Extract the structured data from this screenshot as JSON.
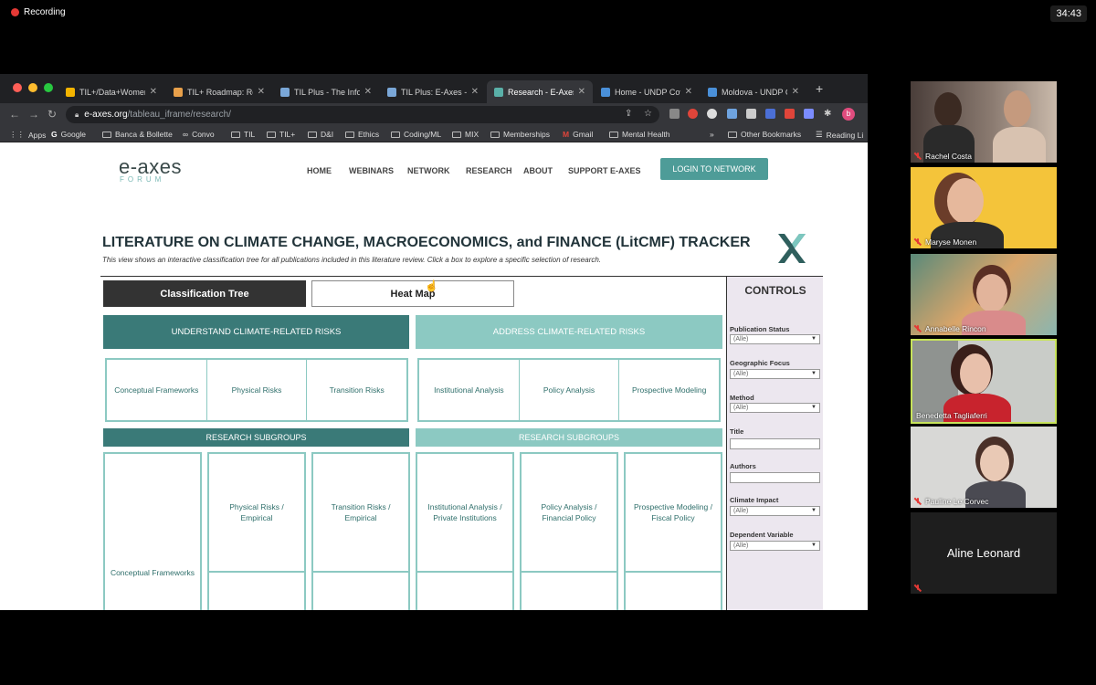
{
  "zoom": {
    "recording_label": "Recording",
    "timer": "34:43"
  },
  "browser": {
    "tabs": [
      {
        "label": "TIL+/Data+Womer",
        "fav_color": "#f4b400"
      },
      {
        "label": "TIL+ Roadmap: Ro",
        "fav_color": "#e8a04a"
      },
      {
        "label": "TIL Plus - The Infor",
        "fav_color": "#7aa7d8"
      },
      {
        "label": "TIL Plus: E-Axes - T",
        "fav_color": "#7aa7d8"
      },
      {
        "label": "Research - E-Axes",
        "fav_color": "#5ab0a8"
      },
      {
        "label": "Home - UNDP Cov",
        "fav_color": "#4a90d9"
      },
      {
        "label": "Moldova - UNDP C",
        "fav_color": "#4a90d9"
      }
    ],
    "url_host": "e-axes.org",
    "url_path": "/tableau_iframe/research/",
    "bookmarks": [
      "Apps",
      "Google",
      "Banca & Bollette",
      "Convo",
      "TIL",
      "TIL+",
      "D&I",
      "Ethics",
      "Coding/ML",
      "MIX",
      "Memberships",
      "Gmail",
      "Mental Health",
      "»",
      "Other Bookmarks",
      "Reading Li"
    ]
  },
  "site": {
    "logo_main": "e-axes",
    "logo_sub": "FORUM",
    "nav": [
      "HOME",
      "WEBINARS",
      "NETWORK",
      "RESEARCH",
      "ABOUT",
      "SUPPORT E-AXES"
    ],
    "login": "LOGIN TO NETWORK"
  },
  "tracker": {
    "title": "LITERATURE ON CLIMATE CHANGE, MACROECONOMICS, and FINANCE (LitCMF) TRACKER",
    "subtitle": "This view shows an interactive classification tree for all publications included in this literature review. Click a box to explore a specific selection of research.",
    "tab_classification": "Classification Tree",
    "tab_heatmap": "Heat Map",
    "understand": "UNDERSTAND CLIMATE-RELATED RISKS",
    "address": "ADDRESS CLIMATE-RELATED RISKS",
    "understand_cats": [
      "Conceptual Frameworks",
      "Physical Risks",
      "Transition Risks"
    ],
    "address_cats": [
      "Institutional Analysis",
      "Policy Analysis",
      "Prospective Modeling"
    ],
    "subgroups_label": "RESEARCH SUBGROUPS",
    "subgroups": [
      "Conceptual Frameworks",
      "Physical Risks / Empirical",
      "Transition Risks / Empirical",
      "Institutional Analysis / Private Institutions",
      "Policy Analysis / Financial Policy",
      "Prospective Modeling / Fiscal Policy"
    ]
  },
  "controls": {
    "title": "CONTROLS",
    "publication_status": {
      "label": "Publication Status",
      "value": "(Alle)"
    },
    "geographic_focus": {
      "label": "Geographic Focus",
      "value": "(Alle)"
    },
    "method": {
      "label": "Method",
      "value": "(Alle)"
    },
    "title_field": {
      "label": "Title"
    },
    "authors": {
      "label": "Authors"
    },
    "climate_impact": {
      "label": "Climate Impact",
      "value": "(Alle)"
    },
    "dependent_variable": {
      "label": "Dependent Variable",
      "value": "(Alle)"
    }
  },
  "participants": [
    {
      "name": "Rachel Costa"
    },
    {
      "name": "Maryse Monen"
    },
    {
      "name": "Annabelle Rincon"
    },
    {
      "name": "Benedetta Tagliaferri"
    },
    {
      "name": "Pauline Le Corvec"
    },
    {
      "name": "Aline Leonard"
    }
  ]
}
